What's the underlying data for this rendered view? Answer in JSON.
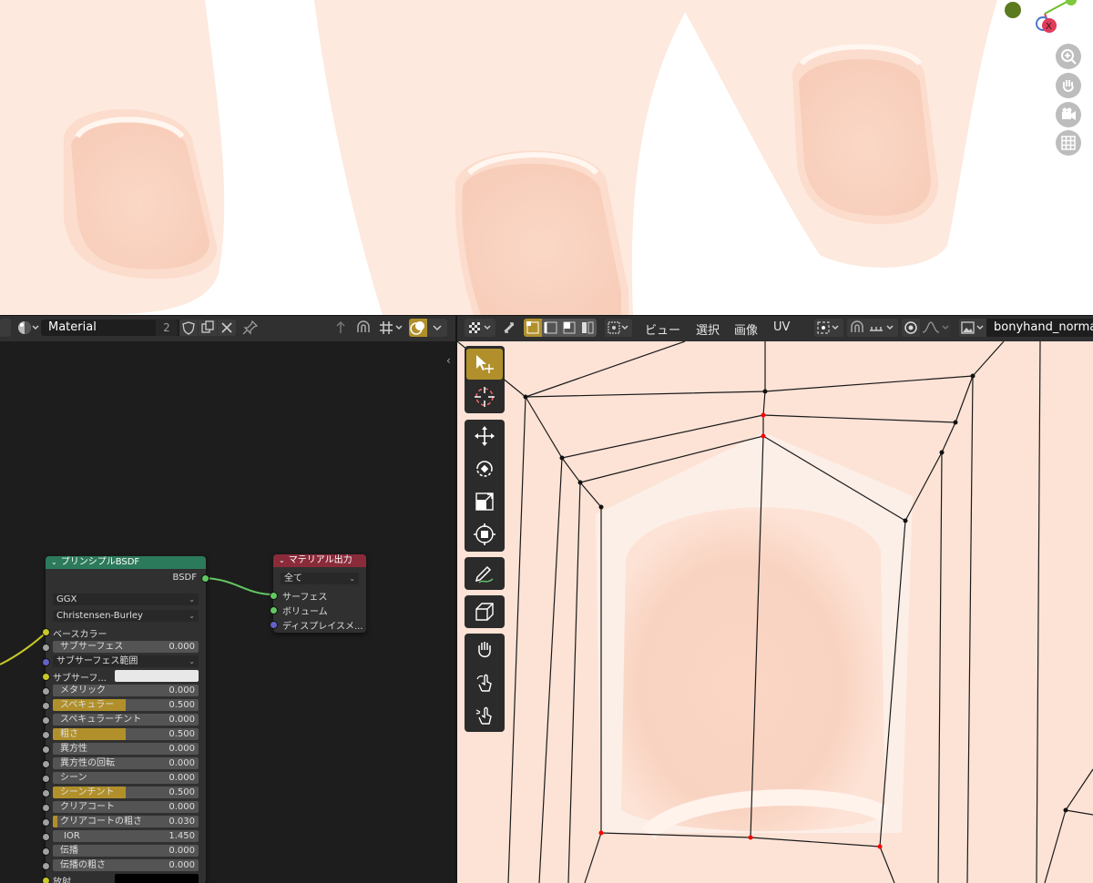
{
  "node_header": {
    "material_name": "Material",
    "user_count": "2"
  },
  "uv_header": {
    "menus": [
      "ビュー",
      "選択",
      "画像",
      "UV"
    ],
    "image_name": "bonyhand_norma"
  },
  "principled_node": {
    "title": "プリンシプルBSDF",
    "output": "BSDF",
    "distribution": "GGX",
    "subsurface_method": "Christensen-Burley",
    "base_color_label": "ベースカラー",
    "rows": [
      {
        "label": "サブサーフェス",
        "value": "0.000",
        "fill": 0
      },
      {
        "label": "サブサーフェス範囲",
        "value": "",
        "fill": 0
      },
      {
        "label": "サブサーフ...",
        "value": "",
        "fill": 0
      },
      {
        "label": "メタリック",
        "value": "0.000",
        "fill": 0
      },
      {
        "label": "スペキュラー",
        "value": "0.500",
        "fill": 0.5
      },
      {
        "label": "スペキュラーチント",
        "value": "0.000",
        "fill": 0
      },
      {
        "label": "粗さ",
        "value": "0.500",
        "fill": 0.5
      },
      {
        "label": "異方性",
        "value": "0.000",
        "fill": 0
      },
      {
        "label": "異方性の回転",
        "value": "0.000",
        "fill": 0
      },
      {
        "label": "シーン",
        "value": "0.000",
        "fill": 0
      },
      {
        "label": "シーンチント",
        "value": "0.500",
        "fill": 0.5
      },
      {
        "label": "クリアコート",
        "value": "0.000",
        "fill": 0
      },
      {
        "label": "クリアコートの粗さ",
        "value": "0.030",
        "fill": 0.03
      },
      {
        "label": "IOR",
        "value": "1.450",
        "fill": 0
      },
      {
        "label": "伝播",
        "value": "0.000",
        "fill": 0
      },
      {
        "label": "伝播の粗さ",
        "value": "0.000",
        "fill": 0
      },
      {
        "label": "放射",
        "value": "",
        "fill": 0
      }
    ]
  },
  "output_node": {
    "title": "マテリアル出力",
    "target": "全て",
    "inputs": [
      "サーフェス",
      "ボリューム",
      "ディスプレイスメ..."
    ]
  },
  "colors": {
    "accent_gold": "#b1902b",
    "principled_header": "#2c7a5c",
    "output_header": "#8a2b3a",
    "uv_background": "#fde3d6",
    "socket_yellow": "#c7c729",
    "socket_gray": "#a1a1a1",
    "socket_purple": "#6363c7",
    "socket_green": "#63c763",
    "uv_selected_vertex": "#ff0000"
  }
}
